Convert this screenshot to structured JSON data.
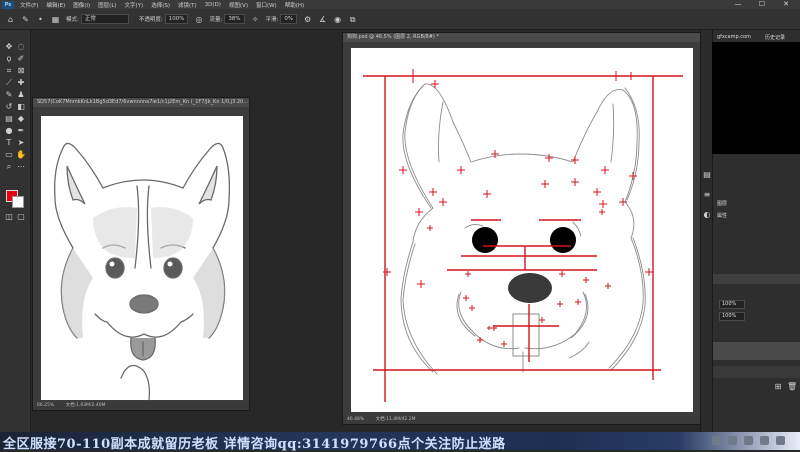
{
  "menubar": {
    "logo": "Ps",
    "items": [
      "文件(F)",
      "编辑(E)",
      "图像(I)",
      "图层(L)",
      "文字(Y)",
      "选择(S)",
      "滤镜(T)",
      "3D(D)",
      "视图(V)",
      "窗口(W)",
      "帮助(H)"
    ],
    "min": "—",
    "max": "☐",
    "close": "✕"
  },
  "options": {
    "mode_label": "模式:",
    "mode_value": "正常",
    "opacity_label": "不透明度:",
    "opacity_value": "100%",
    "flow_label": "流量:",
    "flow_value": "38%",
    "smooth_label": "平滑:",
    "smooth_value": "0%"
  },
  "ref_doc": {
    "title": "SD57(CoK7MnmkKnLk1Bg5d3Ed7/6vwnnnna7ie1/c1j2Em_Kn (_1F7/Jk_Kn 1/0,j3 20...",
    "zoom": "66.25%",
    "doc_info": "文档:1.03M/2.40M"
  },
  "main_doc": {
    "title": "狗狗.psd @ 46.5% (图层 2, RGB/8#) *",
    "zoom": "46.48%",
    "doc_info": "文档:11.4M/42.2M"
  },
  "right_panel": {
    "tab_text": "gfxcamp.com",
    "tab_label2": "历史记录",
    "layer_label1": "图层",
    "layer_label2": "属性",
    "opacity1": "100%",
    "opacity2": "100%"
  },
  "banner": {
    "text": "全区服接70-110副本成就留历老板 详情咨询qq:3141979766点个关注防止迷路"
  },
  "colors": {
    "foreground": "#e60012",
    "background": "#ffffff",
    "guides": "#d4141c"
  }
}
